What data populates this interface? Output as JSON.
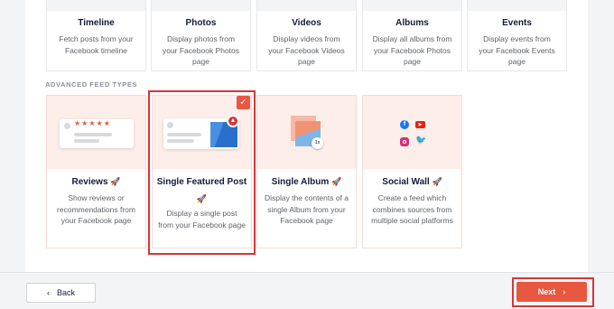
{
  "basic_feeds": [
    {
      "title": "Timeline",
      "desc": "Fetch posts from your Facebook timeline"
    },
    {
      "title": "Photos",
      "desc": "Display photos from your Facebook Photos page"
    },
    {
      "title": "Videos",
      "desc": "Display videos from your Facebook Videos page"
    },
    {
      "title": "Albums",
      "desc": "Display all albums from your Facebook Photos page"
    },
    {
      "title": "Events",
      "desc": "Display events from your Facebook Events page"
    }
  ],
  "section_label": "ADVANCED FEED TYPES",
  "advanced_feeds": [
    {
      "title": "Reviews",
      "desc": "Show reviews or recommendations from your Facebook page"
    },
    {
      "title": "Single Featured Post",
      "desc": "Display a single post from your Facebook page"
    },
    {
      "title": "Single Album",
      "desc": "Display the contents of a single Album from your Facebook page"
    },
    {
      "title": "Social Wall",
      "desc": "Create a feed which combines sources from multiple social platforms"
    }
  ],
  "footer": {
    "back_label": "Back",
    "next_label": "Next"
  },
  "colors": {
    "accent": "#e8573f",
    "selection": "#d63638"
  },
  "icons": {
    "rocket": "rocket-icon",
    "check": "check-icon",
    "back": "chevron-left-icon",
    "next": "chevron-right-icon"
  }
}
